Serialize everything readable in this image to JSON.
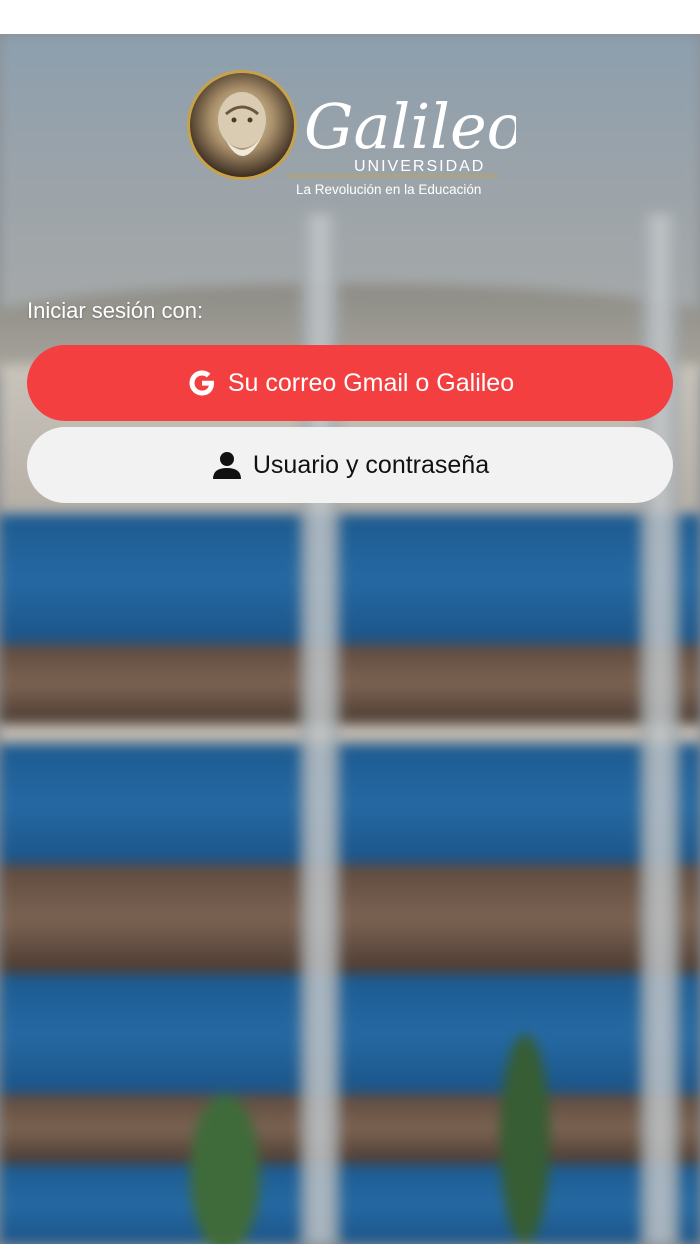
{
  "logo": {
    "wordmark": "Galileo",
    "subtitle": "UNIVERSIDAD",
    "tagline": "La Revolución en la Educación"
  },
  "login": {
    "prompt": "Iniciar sesión con:",
    "google_button": {
      "label": "Su correo Gmail o Galileo",
      "icon": "google-icon",
      "color": "#f43f41"
    },
    "user_button": {
      "label": "Usuario y contraseña",
      "icon": "user-icon",
      "color": "#f2f2f2"
    }
  }
}
